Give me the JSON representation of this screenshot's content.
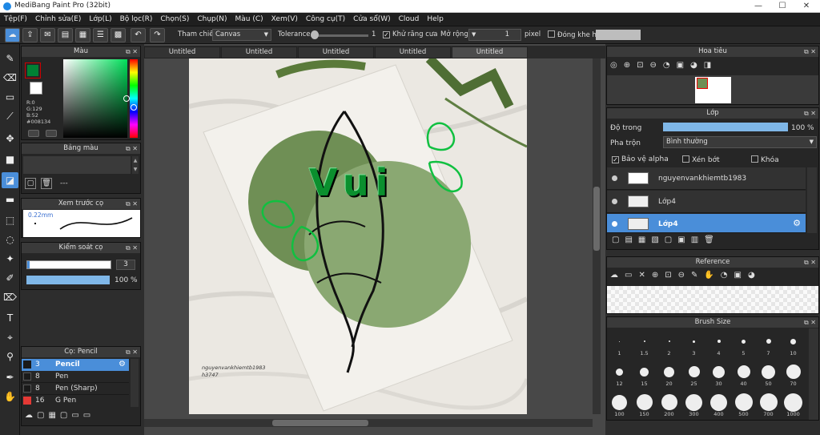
{
  "app": {
    "title": "MediBang Paint Pro (32bit)"
  },
  "menu": [
    "Tệp(F)",
    "Chỉnh sửa(E)",
    "Lớp(L)",
    "Bộ lọc(R)",
    "Chọn(S)",
    "Chụp(N)",
    "Màu (C)",
    "Xem(V)",
    "Công cụ(T)",
    "Cửa sổ(W)",
    "Cloud",
    "Help"
  ],
  "toolbar": {
    "ref_label": "Tham chiếu",
    "ref_value": "Canvas",
    "tolerance_label": "Tolerance",
    "tolerance_value": "1",
    "antialias_label": "Khử răng cưa",
    "expand_label": "Mở rộng",
    "expand_value": "1",
    "expand_unit": "pixel",
    "close_gap_label": "Đóng khe hở"
  },
  "color_panel": {
    "title": "Màu",
    "r": "R:0",
    "g": "G:129",
    "b": "B:52",
    "hex": "#008134",
    "primary": "#008134"
  },
  "palette_panel": {
    "title": "Bảng màu",
    "field": "---"
  },
  "brush_preview": {
    "title": "Xem trước cọ",
    "size": "0.22mm"
  },
  "brush_control": {
    "title": "Kiểm soát cọ",
    "size": "3",
    "opacity": "100 %"
  },
  "brush_list": {
    "title": "Cọ: Pencil",
    "items": [
      {
        "size": "3",
        "name": "Pencil",
        "color": "#1a1a1a"
      },
      {
        "size": "8",
        "name": "Pen",
        "color": "#1a1a1a"
      },
      {
        "size": "8",
        "name": "Pen (Sharp)",
        "color": "#1a1a1a"
      },
      {
        "size": "16",
        "name": "G Pen",
        "color": "#e53935"
      }
    ]
  },
  "tabs": [
    "Untitled",
    "Untitled",
    "Untitled",
    "Untitled",
    "Untitled"
  ],
  "artwork": {
    "lettering": "Vui",
    "signature_line1": "nguyenvankhiemtb1983",
    "signature_line2": "h3747"
  },
  "navigator": {
    "title": "Hoa tiêu"
  },
  "layer_panel": {
    "title": "Lớp",
    "opacity_label": "Độ trong",
    "opacity_value": "100 %",
    "blend_label": "Pha trộn",
    "blend_value": "Bình thường",
    "protect_alpha": "Bảo vệ alpha",
    "clipping": "Xén bớt",
    "lock": "Khóa",
    "layers": [
      {
        "name": "nguyenvankhiemtb1983"
      },
      {
        "name": "Lớp4"
      },
      {
        "name": "Lớp4"
      }
    ]
  },
  "reference": {
    "title": "Reference"
  },
  "brush_size": {
    "title": "Brush Size",
    "sizes": [
      "1",
      "1.5",
      "2",
      "3",
      "4",
      "5",
      "7",
      "10",
      "12",
      "15",
      "20",
      "25",
      "30",
      "40",
      "50",
      "70",
      "100",
      "150",
      "200",
      "300",
      "400",
      "500",
      "700",
      "1000"
    ]
  }
}
